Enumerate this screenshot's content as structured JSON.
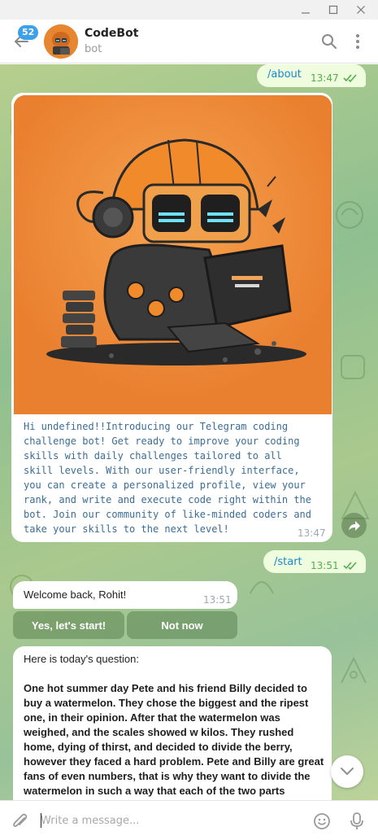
{
  "header": {
    "unread_badge": "52",
    "title": "CodeBot",
    "subtitle": "bot"
  },
  "messages": {
    "about": {
      "text": "/about",
      "time": "13:47"
    },
    "intro": {
      "text": "Hi undefined!!Introducing our Telegram coding challenge bot! Get ready to improve your coding skills with daily challenges tailored to all skill levels. With our user-friendly interface, you can create a personalized profile, view your rank, and write and execute code right within the bot. Join our community of like-minded coders and take your skills to the next level!",
      "time": "13:47"
    },
    "start": {
      "text": "/start",
      "time": "13:51"
    },
    "welcome": {
      "text": "Welcome back, Rohit!",
      "time": "13:51"
    },
    "keyboard": {
      "yes_label": "Yes, let's start!",
      "no_label": "Not now"
    },
    "question": {
      "heading": "Here is today's question:",
      "body": "One hot summer day Pete and his friend Billy decided to buy a watermelon. They chose the biggest and the ripest one, in their opinion. After that the watermelon was weighed, and the scales showed w kilos. They rushed home, dying of thirst, and decided to divide the berry, however they faced a hard problem. Pete and Billy are great fans of even numbers, that is why they want to divide the watermelon in such a way that each of the two parts"
    }
  },
  "composer": {
    "placeholder": "Write a message..."
  },
  "colors": {
    "accent": "#168acd",
    "out_bubble": "#effdde",
    "in_bubble": "#ffffff",
    "check": "#4fae4e",
    "mono_text": "#3a6d96",
    "photo_bg": "#ec8a3c"
  },
  "icons": {
    "back": "back-arrow-icon",
    "search": "search-icon",
    "more": "more-vertical-icon",
    "forward": "forward-icon",
    "scroll_down": "chevron-down-icon",
    "attach": "paperclip-icon",
    "emoji": "emoji-icon",
    "mic": "microphone-icon"
  }
}
